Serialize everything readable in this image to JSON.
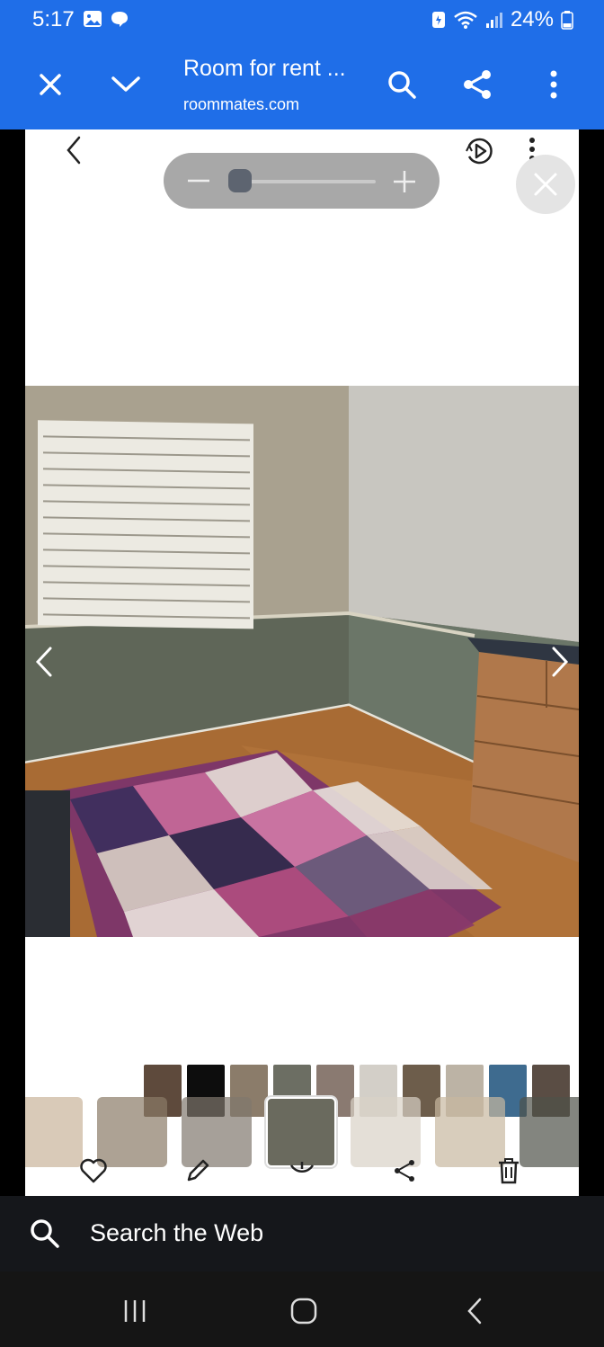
{
  "status_bar": {
    "time": "5:17",
    "battery": "24%"
  },
  "app_bar": {
    "title": "Room for rent ...",
    "url": "roommates.com"
  },
  "search_bar": {
    "label": "Search the Web"
  },
  "icons": {
    "close": "close-icon",
    "dropdown": "chevron-down-icon",
    "search": "search-icon",
    "share": "share-icon",
    "more": "more-vert-icon",
    "back": "chevron-left-icon",
    "next": "chevron-right-icon",
    "motion": "motion-photo-icon",
    "zoom_out": "minus-icon",
    "zoom_in": "plus-icon",
    "favorite": "heart-icon",
    "edit": "pencil-icon",
    "info": "info-icon",
    "delete": "trash-icon",
    "nav_recent": "recent-apps-icon",
    "nav_home": "home-icon",
    "nav_back": "back-icon"
  },
  "colors": {
    "brand_blue": "#1f6ee8"
  }
}
